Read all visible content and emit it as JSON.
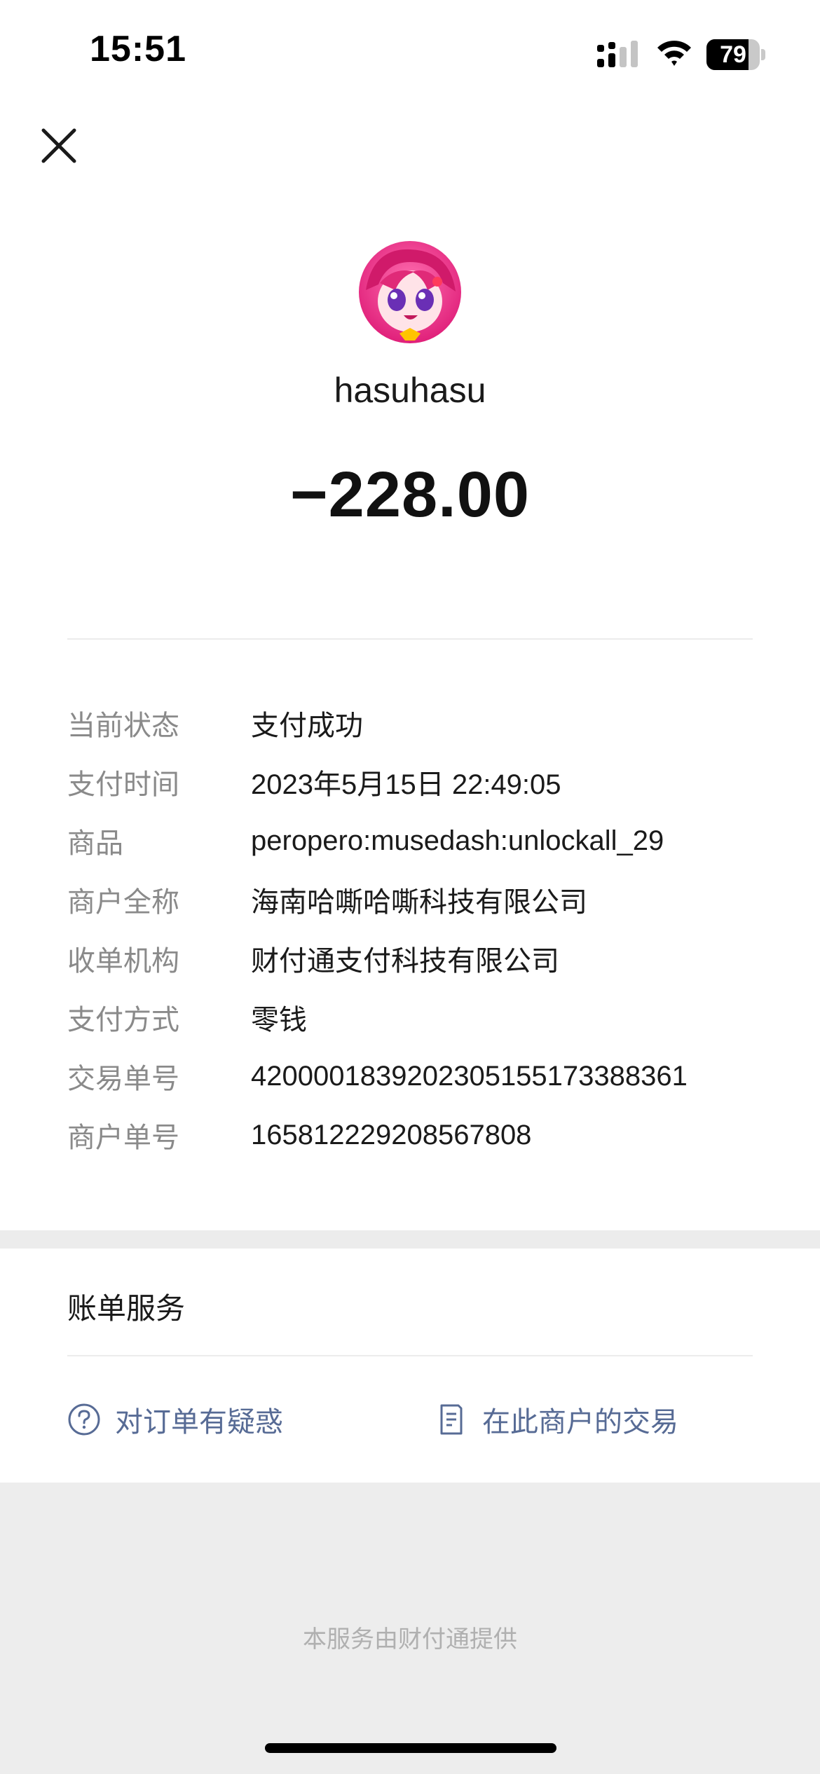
{
  "status_bar": {
    "time": "15:51",
    "battery": "79",
    "battery_level": 0.79,
    "icons": [
      "signal-icon",
      "wifi-icon",
      "battery-icon"
    ]
  },
  "header": {
    "close_icon": "close-icon",
    "avatar_icon": "anime-avatar",
    "name": "hasuhasu",
    "amount": "−228.00"
  },
  "details": [
    {
      "label": "当前状态",
      "value": "支付成功"
    },
    {
      "label": "支付时间",
      "value": "2023年5月15日 22:49:05"
    },
    {
      "label": "商品",
      "value": "peropero:musedash:unlockall_29"
    },
    {
      "label": "商户全称",
      "value": "海南哈嘶哈嘶科技有限公司"
    },
    {
      "label": "收单机构",
      "value": "财付通支付科技有限公司"
    },
    {
      "label": "支付方式",
      "value": "零钱"
    },
    {
      "label": "交易单号",
      "value": "4200001839202305155173388361"
    },
    {
      "label": "商户单号",
      "value": "165812229208567808"
    }
  ],
  "bill_service": {
    "title": "账单服务",
    "actions": [
      {
        "label": "对订单有疑惑",
        "icon": "question-circle-icon"
      },
      {
        "label": "在此商户的交易",
        "icon": "document-icon"
      }
    ]
  },
  "footer": {
    "text": "本服务由财付通提供"
  },
  "colors": {
    "link": "#576b95",
    "label_gray": "#8a8a8a",
    "separator": "#ececec"
  }
}
